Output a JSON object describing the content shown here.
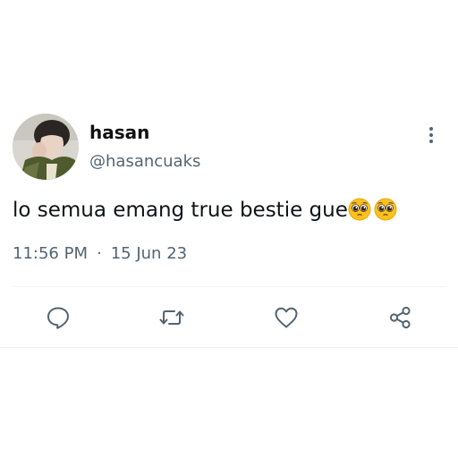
{
  "tweet": {
    "display_name": "hasan",
    "handle": "@hasancuaks",
    "text": "lo semua emang true bestie gue",
    "emojis": [
      "pleading-face",
      "pleading-face"
    ],
    "time": "11:56 PM",
    "separator": "·",
    "date": "15 Jun 23"
  },
  "actions": [
    {
      "name": "reply",
      "icon": "speech-bubble-icon"
    },
    {
      "name": "retweet",
      "icon": "retweet-arrows-icon"
    },
    {
      "name": "like",
      "icon": "heart-icon"
    },
    {
      "name": "share",
      "icon": "share-nodes-icon"
    }
  ],
  "colors": {
    "text": "#0f1419",
    "secondary": "#536471",
    "divider": "#eff3f4",
    "background": "#ffffff"
  }
}
